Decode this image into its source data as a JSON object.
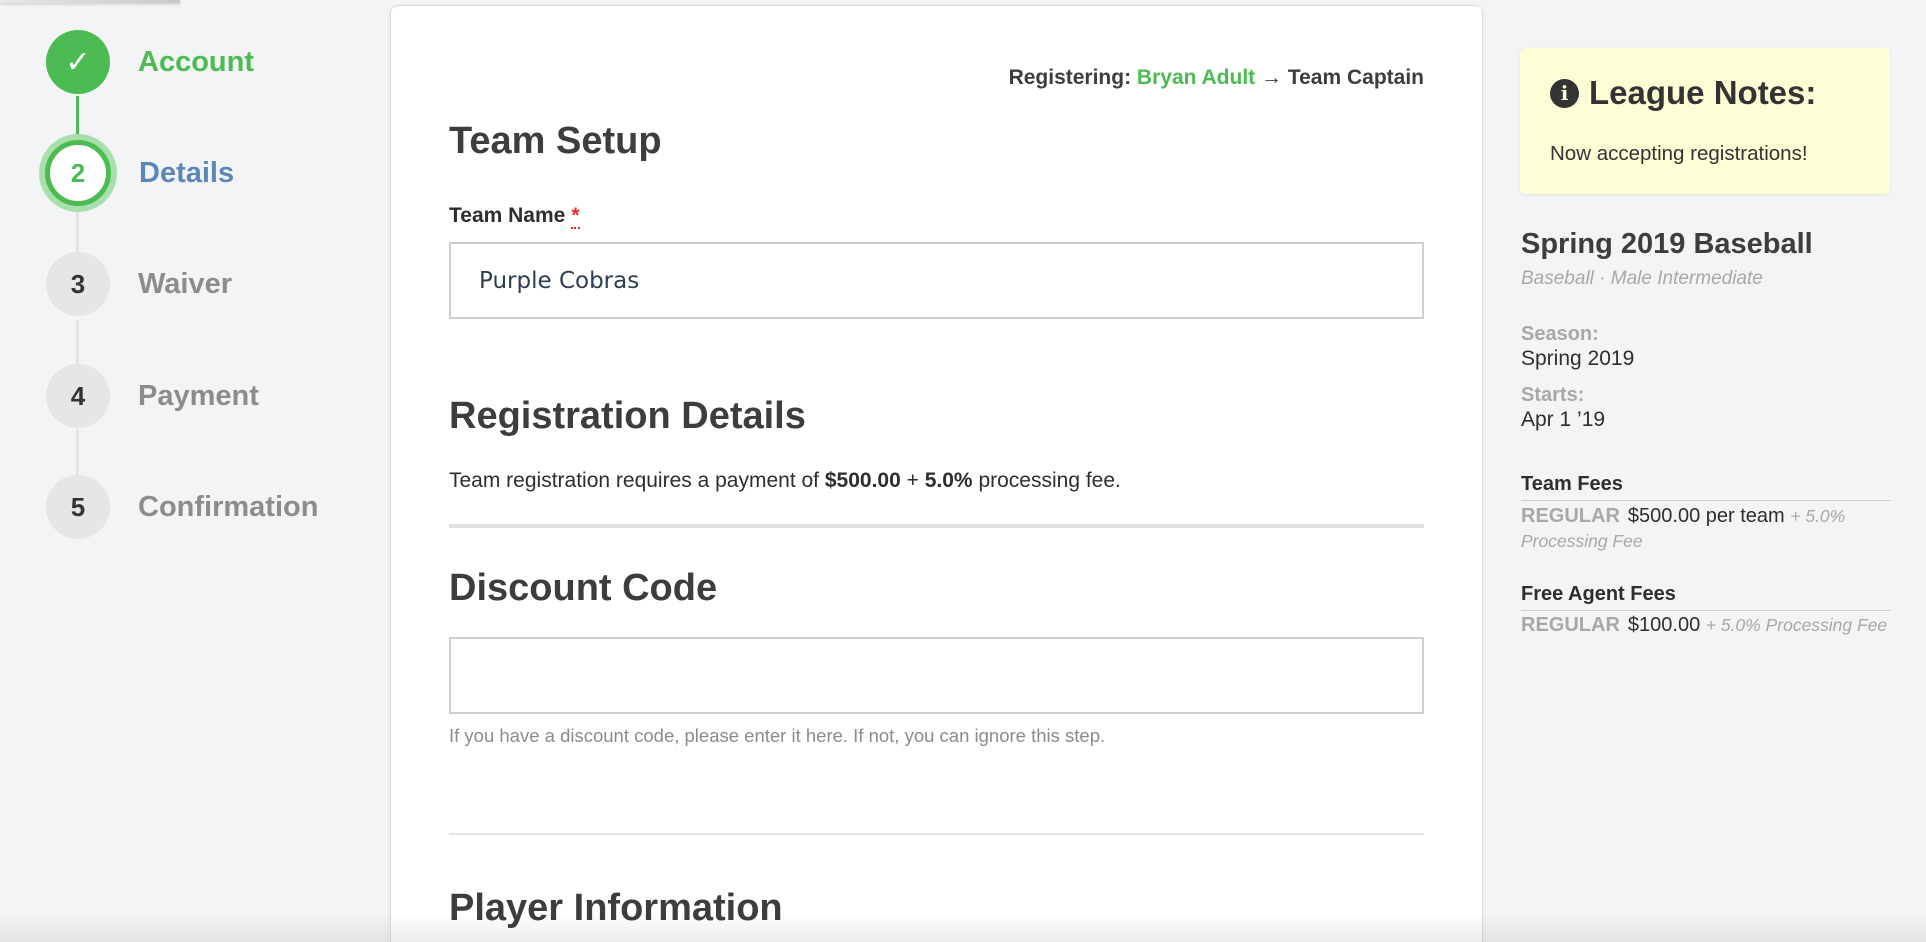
{
  "stepper": {
    "steps": [
      {
        "marker": "✓",
        "label": "Account",
        "state": "done"
      },
      {
        "marker": "2",
        "label": "Details",
        "state": "active"
      },
      {
        "marker": "3",
        "label": "Waiver",
        "state": "pending"
      },
      {
        "marker": "4",
        "label": "Payment",
        "state": "pending"
      },
      {
        "marker": "5",
        "label": "Confirmation",
        "state": "pending"
      }
    ]
  },
  "main": {
    "registering": {
      "prefix": "Registering:",
      "person": "Bryan Adult",
      "arrow": "→",
      "role": "Team Captain"
    },
    "team_setup": {
      "title": "Team Setup",
      "team_name_label": "Team Name",
      "required_marker": "*",
      "team_name_value": "Purple Cobras"
    },
    "registration_details": {
      "title": "Registration Details",
      "text_before": "Team registration requires a payment of",
      "amount": "$500.00",
      "plus": "+",
      "fee_pct": "5.0%",
      "text_after": "processing fee."
    },
    "discount": {
      "title": "Discount Code",
      "value": "",
      "help": "If you have a discount code, please enter it here. If not, you can ignore this step."
    },
    "player_info": {
      "title": "Player Information"
    }
  },
  "sidebar": {
    "notes": {
      "title": "League Notes:",
      "text": "Now accepting registrations!"
    },
    "league": {
      "title": "Spring 2019 Baseball",
      "subtitle": "Baseball · Male Intermediate",
      "season_label": "Season:",
      "season_value": "Spring 2019",
      "starts_label": "Starts:",
      "starts_value": "Apr 1 ’19"
    },
    "team_fees": {
      "title": "Team Fees",
      "tier": "REGULAR",
      "amount": "$500.00 per team",
      "extra": "+ 5.0% Processing Fee"
    },
    "free_agent_fees": {
      "title": "Free Agent Fees",
      "tier": "REGULAR",
      "amount": "$100.00",
      "extra": "+ 5.0% Processing Fee"
    }
  },
  "colors": {
    "accent_green": "#4cbb52",
    "active_blue": "#5b86b5",
    "notes_bg": "#fdfdd6",
    "required_red": "#e0322b"
  }
}
